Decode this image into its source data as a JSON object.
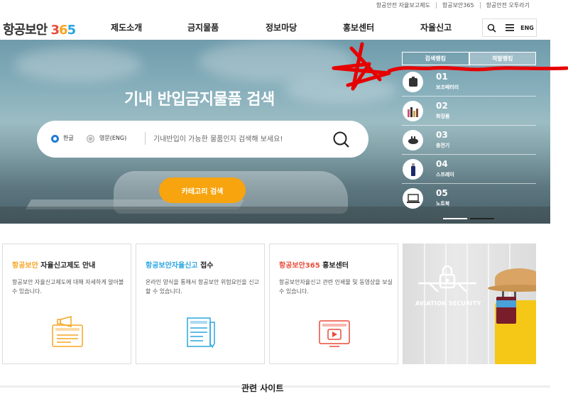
{
  "utility_links": [
    "항공안전 자율보고제도",
    "항공보안365",
    "항공안전 오투라기"
  ],
  "header": {
    "logo_text": "항공보안 ",
    "logo_num1": "3",
    "logo_num2": "6",
    "logo_num3": "5",
    "nav": [
      "제도소개",
      "금지물품",
      "정보마당",
      "홍보센터",
      "자율신고"
    ],
    "lang": "ENG"
  },
  "hero": {
    "title": "기내 반입금지물품 검색",
    "radio_korean": "한글",
    "radio_english": "영문(ENG)",
    "search_placeholder": "기내반입이 가능한 물품인지 검색해 보세요!",
    "category_button": "카테고리 검색"
  },
  "ranking": {
    "tabs": [
      "검색랭킹",
      "적발랭킹"
    ],
    "active_tab": "적발랭킹",
    "items": [
      {
        "num": "01",
        "name": "보조배터리",
        "icon": "battery-icon"
      },
      {
        "num": "02",
        "name": "화장품",
        "icon": "cosmetics-icon"
      },
      {
        "num": "03",
        "name": "충전기",
        "icon": "charger-icon"
      },
      {
        "num": "04",
        "name": "스프레이",
        "icon": "spray-icon"
      },
      {
        "num": "05",
        "name": "노트북",
        "icon": "laptop-icon"
      }
    ]
  },
  "cards": [
    {
      "title_highlight": "항공보안",
      "title_rest": " 자율신고제도 안내",
      "desc": "항공보안 자율신고제도에 대해 자세하게 알아볼 수 있습니다.",
      "icon": "megaphone-icon",
      "color": "#f5a623"
    },
    {
      "title_highlight": "항공보안자율신고",
      "title_rest": " 접수",
      "desc": "온라인 양식을 통해서 항공보안 위험요인을 신고할 수 있습니다.",
      "icon": "document-icon",
      "color": "#2aa6df"
    },
    {
      "title_highlight": "항공보안365",
      "title_rest": " 홍보센터",
      "desc": "항공보안자율신고 관련 인쇄물 및 동영상을 보실 수 있습니다.",
      "icon": "video-icon",
      "color": "#e94d3a"
    }
  ],
  "aviation_banner": "AVIATION SECURITY",
  "bottom_title": "관련 사이트"
}
